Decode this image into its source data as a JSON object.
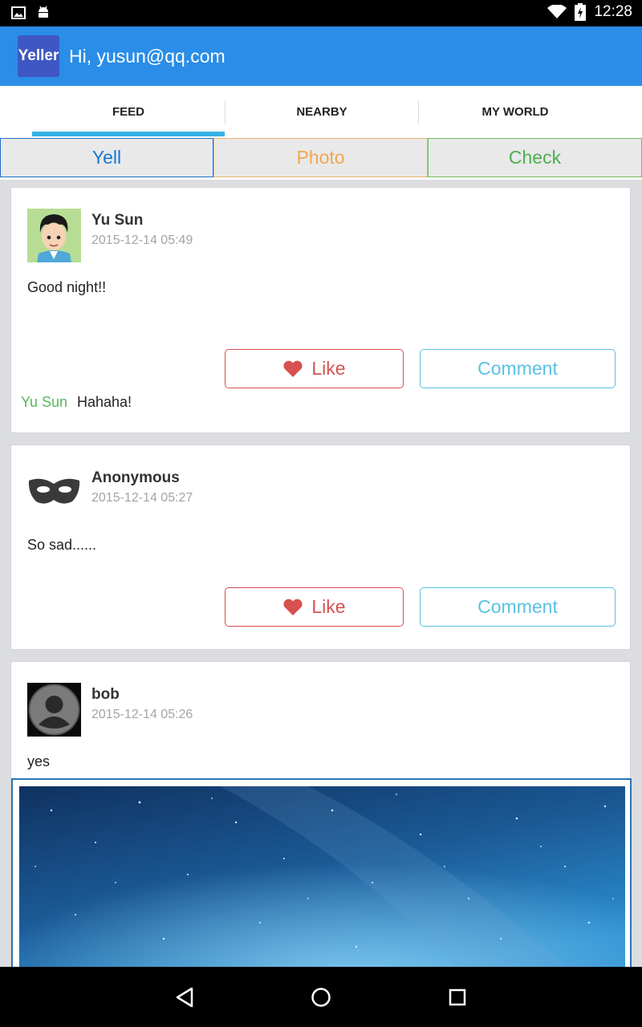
{
  "status_bar": {
    "time": "12:28"
  },
  "app_bar": {
    "logo_text": "Yeller",
    "title": "Hi, yusun@qq.com",
    "color": "#2a8de8"
  },
  "tabs": [
    {
      "label": "FEED",
      "selected": true
    },
    {
      "label": "NEARBY",
      "selected": false
    },
    {
      "label": "MY WORLD",
      "selected": false
    }
  ],
  "post_types": [
    {
      "label": "Yell",
      "color": "#1976d2"
    },
    {
      "label": "Photo",
      "color": "#f0a850"
    },
    {
      "label": "Check",
      "color": "#4caf50"
    }
  ],
  "posts": [
    {
      "user": "Yu Sun",
      "time": "2015-12-14 05:49",
      "text": "Good night!!",
      "like_label": "Like",
      "comment_label": "Comment",
      "comments": [
        {
          "user": "Yu Sun",
          "text": "Hahaha!"
        }
      ]
    },
    {
      "user": "Anonymous",
      "time": "2015-12-14 05:27",
      "text": "So sad......",
      "like_label": "Like",
      "comment_label": "Comment"
    },
    {
      "user": "bob",
      "time": "2015-12-14 05:26",
      "text": "yes"
    }
  ],
  "icons": {
    "like": "heart-icon",
    "back": "back-triangle-icon",
    "home": "home-circle-icon",
    "recents": "recents-square-icon"
  }
}
